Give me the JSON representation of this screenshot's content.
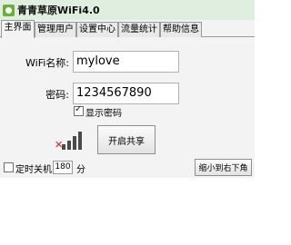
{
  "window": {
    "title": "青青草原WiFi4.0"
  },
  "tabs": [
    {
      "label": "主界面",
      "active": true
    },
    {
      "label": "管理用户",
      "active": false
    },
    {
      "label": "设置中心",
      "active": false
    },
    {
      "label": "流量统计",
      "active": false
    },
    {
      "label": "帮助信息",
      "active": false
    }
  ],
  "form": {
    "ssid_label": "WiFi名称:",
    "ssid_value": "mylove",
    "password_label": "密码:",
    "password_value": "1234567890",
    "show_password_label": "显示密码",
    "show_password_checked": true
  },
  "actions": {
    "start_share_label": "开启共享"
  },
  "footer": {
    "timer_label": "定时关机:",
    "timer_checked": false,
    "timer_value": "180",
    "timer_unit": "分",
    "minimize_label": "缩小到右下角"
  },
  "colors": {
    "titlebar_bg": "#e0eee0",
    "signal_bar": "#4a4a4a",
    "signal_x": "#d02020"
  },
  "icons": {
    "app": "app-logo-icon",
    "signal": "signal-strength-icon"
  }
}
